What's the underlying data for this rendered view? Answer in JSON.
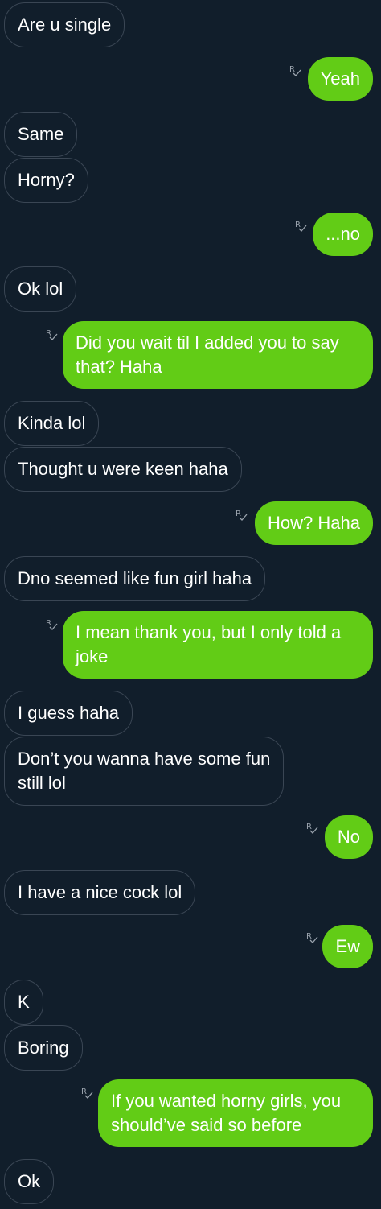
{
  "messages": [
    {
      "dir": "in",
      "text": "Are u single"
    },
    {
      "dir": "out",
      "text": "Yeah",
      "receipt": "R"
    },
    {
      "dir": "in",
      "text": "Same"
    },
    {
      "dir": "in",
      "text": "Horny?"
    },
    {
      "dir": "out",
      "text": "...no",
      "receipt": "R"
    },
    {
      "dir": "in",
      "text": "Ok lol"
    },
    {
      "dir": "out",
      "text": "Did you wait til I added you to say\nthat? Haha",
      "receipt": "R"
    },
    {
      "dir": "in",
      "text": "Kinda lol"
    },
    {
      "dir": "in",
      "text": "Thought u were keen haha"
    },
    {
      "dir": "out",
      "text": "How? Haha",
      "receipt": "R"
    },
    {
      "dir": "in",
      "text": "Dno seemed like fun girl haha"
    },
    {
      "dir": "out",
      "text": "I mean thank you, but I only told a\njoke",
      "receipt": "R"
    },
    {
      "dir": "in",
      "text": "I guess haha"
    },
    {
      "dir": "in",
      "text": "Don’t you wanna have some fun\nstill lol"
    },
    {
      "dir": "out",
      "text": "No",
      "receipt": "R"
    },
    {
      "dir": "in",
      "text": "I have a nice cock lol"
    },
    {
      "dir": "out",
      "text": "Ew",
      "receipt": "R"
    },
    {
      "dir": "in",
      "text": "K"
    },
    {
      "dir": "in",
      "text": "Boring"
    },
    {
      "dir": "out",
      "text": "If you wanted horny girls, you\nshould’ve said so before",
      "receipt": "R"
    },
    {
      "dir": "in",
      "text": "Ok"
    }
  ]
}
